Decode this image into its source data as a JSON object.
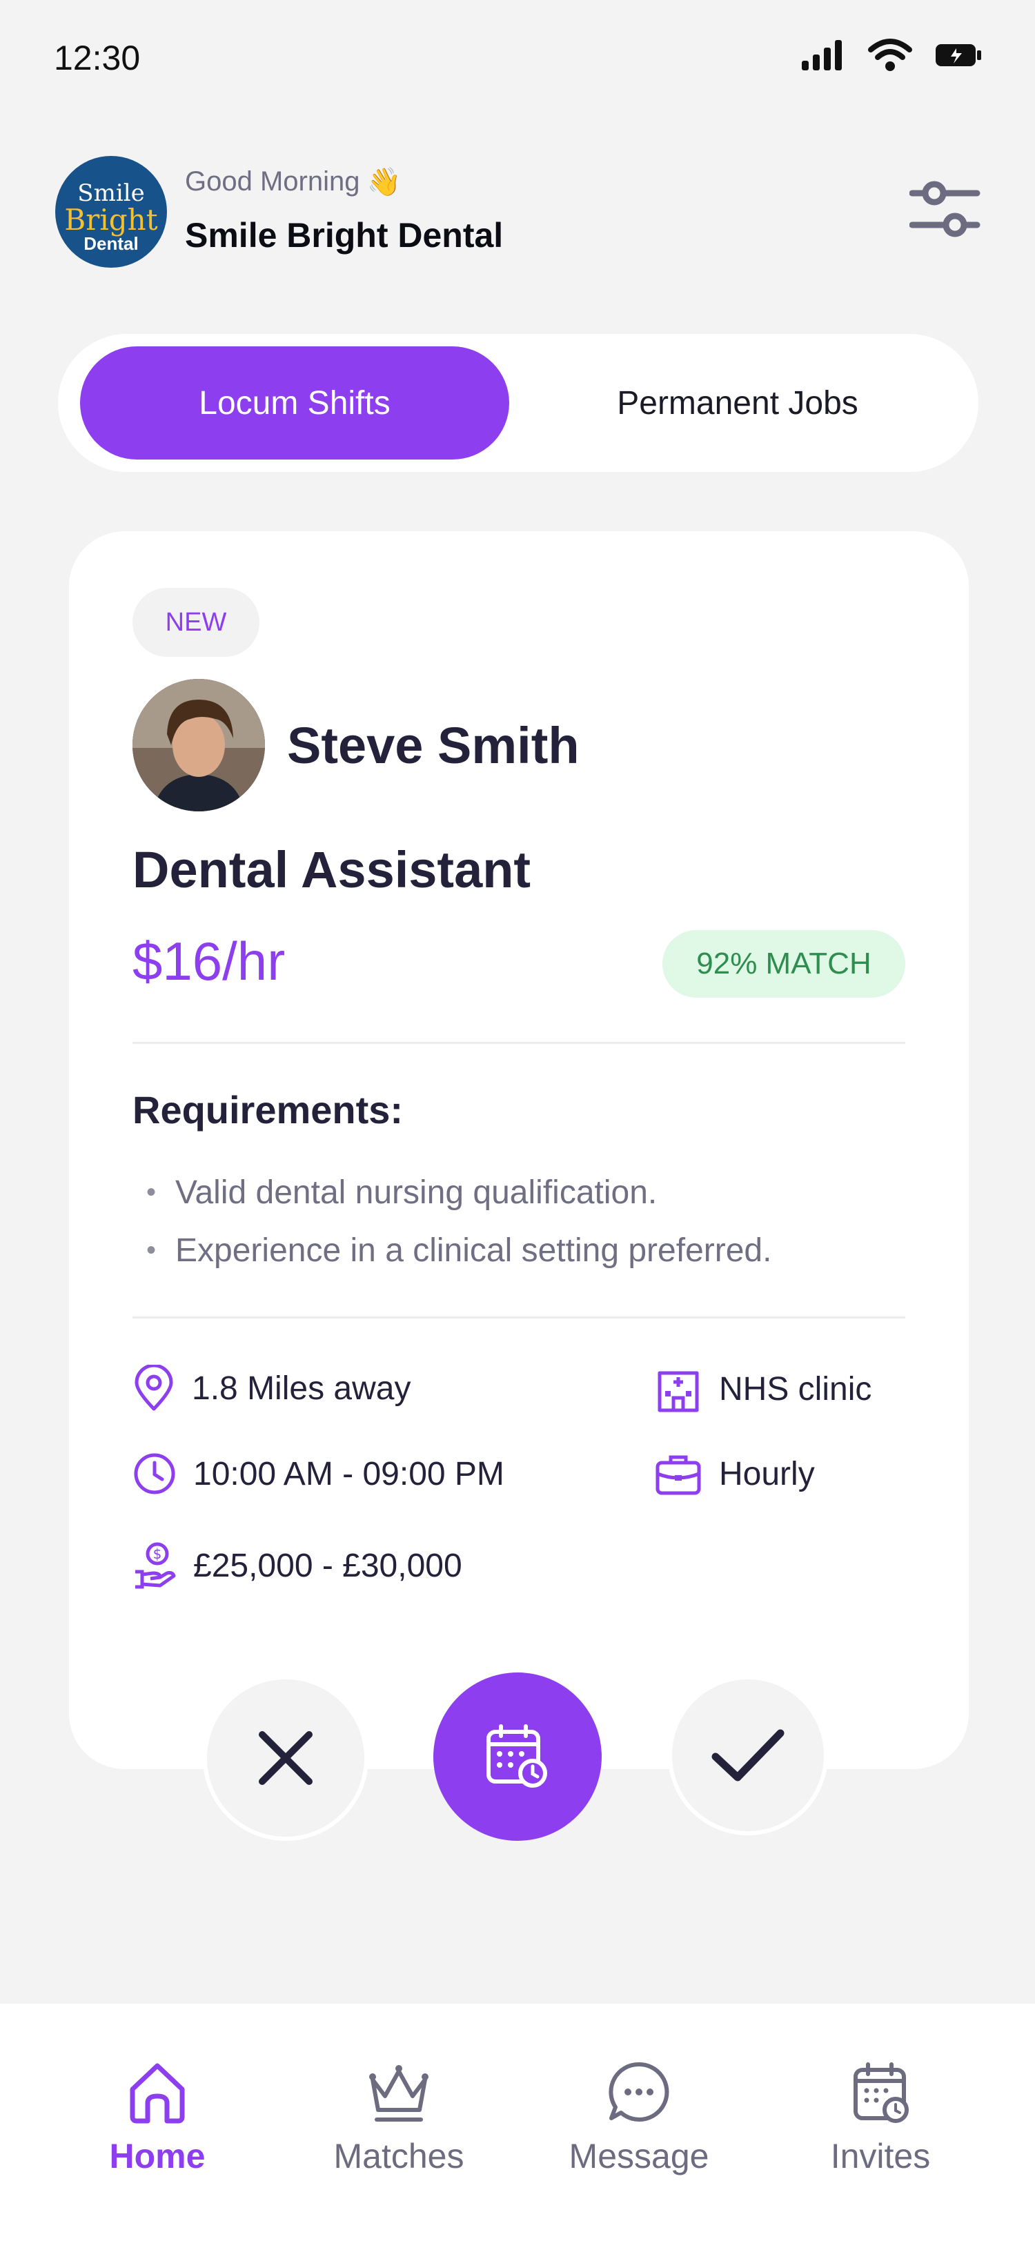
{
  "status_bar": {
    "time": "12:30"
  },
  "header": {
    "logo_line1": "Smile",
    "logo_line2": "Bright",
    "logo_line3": "Dental",
    "greeting": "Good Morning",
    "greeting_emoji": "👋",
    "clinic_name": "Smile Bright Dental",
    "filter_icon": "sliders-icon"
  },
  "segments": {
    "active": "Locum Shifts",
    "inactive": "Permanent Jobs"
  },
  "card": {
    "badge": "NEW",
    "name": "Steve Smith",
    "role": "Dental Assistant",
    "rate": "$16/hr",
    "match": "92% MATCH",
    "requirements_title": "Requirements:",
    "requirements": [
      "Valid dental nursing qualification.",
      "Experience in a clinical setting preferred."
    ],
    "info": {
      "distance": "1.8 Miles away",
      "clinic_type": "NHS clinic",
      "hours": "10:00 AM - 09:00 PM",
      "pay_type": "Hourly",
      "salary": "£25,000 - £30,000"
    }
  },
  "actions": {
    "reject_icon": "close-icon",
    "schedule_icon": "calendar-clock-icon",
    "accept_icon": "check-icon"
  },
  "tabbar": {
    "items": [
      {
        "label": "Home",
        "icon": "home-icon",
        "active": true
      },
      {
        "label": "Matches",
        "icon": "crown-icon",
        "active": false
      },
      {
        "label": "Message",
        "icon": "chat-icon",
        "active": false
      },
      {
        "label": "Invites",
        "icon": "calendar-icon",
        "active": false
      }
    ]
  },
  "colors": {
    "accent": "#8D3FF0",
    "match_bg": "#E0F8E6",
    "match_text": "#2F8E4F",
    "page_bg": "#F3F3F3"
  }
}
